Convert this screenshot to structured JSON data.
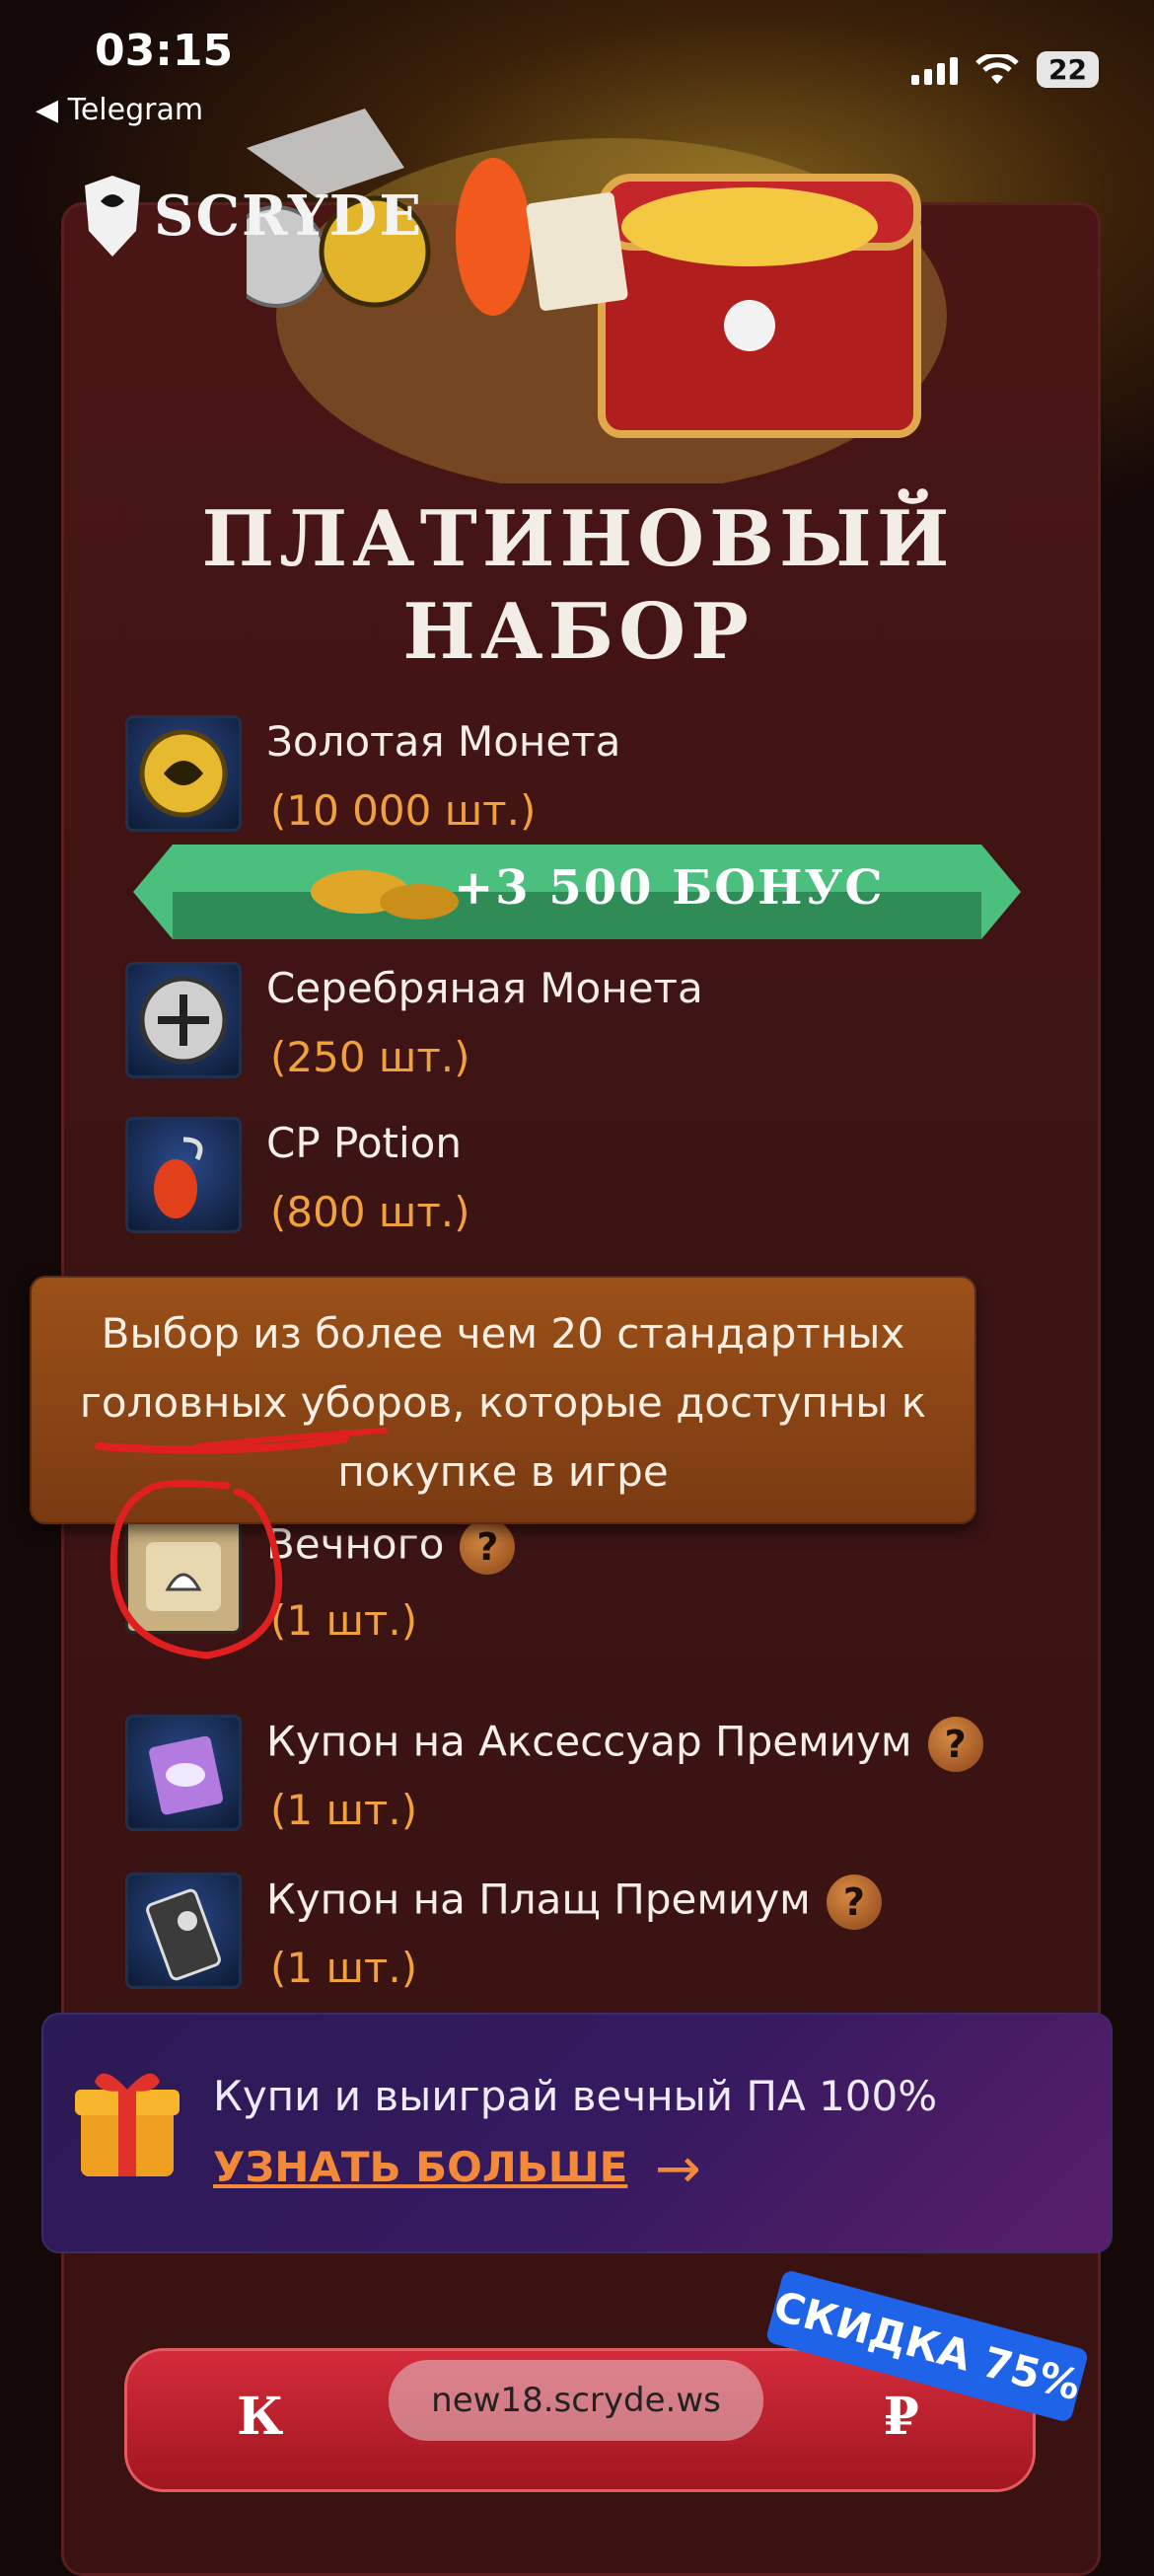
{
  "status": {
    "time": "03:15",
    "back_app": "◀ Telegram",
    "battery": "22"
  },
  "brand": {
    "logo_text": "SCRYDE"
  },
  "pack": {
    "title_line1": "ПЛАТИНОВЫЙ",
    "title_line2": "НАБОР",
    "bonus_label": "+3 500 БОНУС",
    "items": [
      {
        "name": "Золотая Монета",
        "qty": "(10 000 шт.)",
        "icon": "gold-coin-icon"
      },
      {
        "name": "Серебряная Монета",
        "qty": "(250 шт.)",
        "icon": "silver-coin-icon"
      },
      {
        "name": "CP Potion",
        "qty": "(800 шт.)",
        "icon": "potion-icon"
      },
      {
        "name": "Вечного",
        "qty": "(1 шт.)",
        "icon": "cat-scroll-icon",
        "help": "?"
      },
      {
        "name": "Купон на Аксессуар Премиум",
        "qty": "(1 шт.)",
        "icon": "accessory-coupon-icon",
        "help": "?"
      },
      {
        "name": "Купон на Плащ Премиум",
        "qty": "(1 шт.)",
        "icon": "cloak-coupon-icon",
        "help": "?"
      }
    ]
  },
  "tooltip": {
    "text": "Выбор из более чем 20 стандартных головных уборов, которые доступны к покупке в игре"
  },
  "promo": {
    "text": "Купи и выиграй вечный ПА 100%",
    "link": "УЗНАТЬ БОЛЬШЕ",
    "arrow": "→"
  },
  "buy": {
    "label_left": "К",
    "label_right": "₽",
    "url": "new18.scryde.ws",
    "discount": "СКИДКА 75%"
  },
  "colors": {
    "accent": "#f0a13c",
    "card_bg": "#3d1414",
    "ribbon": "#3aa86a",
    "discount": "#1f63e8"
  }
}
